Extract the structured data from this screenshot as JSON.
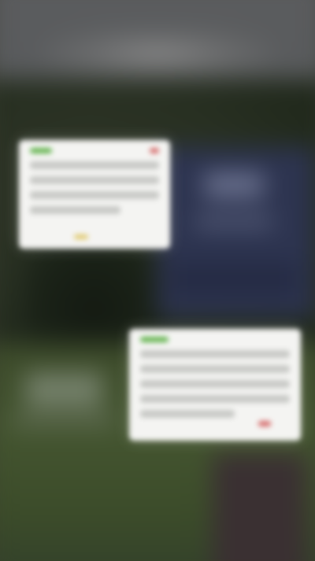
{
  "screen": {
    "title": "",
    "cards": [
      {
        "text": ""
      },
      {
        "text": ""
      }
    ]
  },
  "colors": {
    "card_bg": "#f4f4f2",
    "accent_green": "#63b34e",
    "accent_red": "#d66c6c",
    "accent_yellow": "#e0c86a",
    "panel_blue": "#2d3450"
  }
}
